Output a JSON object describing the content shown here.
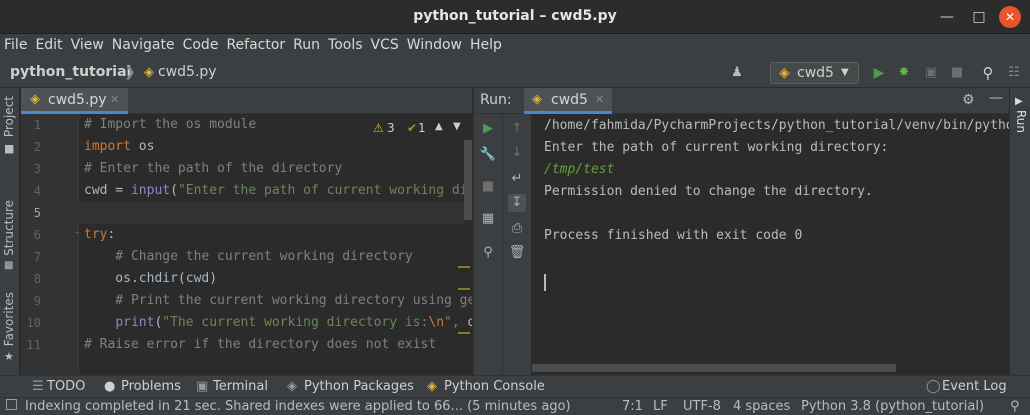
{
  "window": {
    "title": "python_tutorial – cwd5.py"
  },
  "menu": [
    "File",
    "Edit",
    "View",
    "Navigate",
    "Code",
    "Refactor",
    "Run",
    "Tools",
    "VCS",
    "Window",
    "Help"
  ],
  "breadcrumb": {
    "project": "python_tutorial",
    "file": "cwd5.py"
  },
  "run_config": {
    "name": "cwd5"
  },
  "side_tools": {
    "project": "Project",
    "structure": "Structure",
    "favorites": "Favorites",
    "run": "Run"
  },
  "editor": {
    "tab": "cwd5.py",
    "warnings": "3",
    "weak_warnings": "1",
    "current_line": 5,
    "lines": [
      {
        "num": "1",
        "tokens": [
          {
            "t": "# Import the os module",
            "c": "com"
          }
        ]
      },
      {
        "num": "2",
        "tokens": [
          {
            "t": "import",
            "c": "kw"
          },
          {
            "t": " os",
            "c": "def"
          }
        ]
      },
      {
        "num": "3",
        "tokens": [
          {
            "t": "# Enter the path of the directory",
            "c": "com"
          }
        ]
      },
      {
        "num": "4",
        "tokens": [
          {
            "t": "cwd = ",
            "c": "def"
          },
          {
            "t": "input",
            "c": "fn"
          },
          {
            "t": "(",
            "c": "def"
          },
          {
            "t": "\"Enter the path of current working directory: \"",
            "c": "str"
          }
        ]
      },
      {
        "num": "5",
        "tokens": []
      },
      {
        "num": "6",
        "tokens": [
          {
            "t": "try",
            "c": "kw"
          },
          {
            "t": ":",
            "c": "def"
          }
        ]
      },
      {
        "num": "7",
        "tokens": [
          {
            "t": "    # Change the current working directory",
            "c": "com"
          }
        ]
      },
      {
        "num": "8",
        "tokens": [
          {
            "t": "    os.chdir(cwd)",
            "c": "def"
          }
        ]
      },
      {
        "num": "9",
        "tokens": [
          {
            "t": "    # Print the current working directory using getcwd()",
            "c": "com"
          }
        ]
      },
      {
        "num": "10",
        "tokens": [
          {
            "t": "    ",
            "c": "def"
          },
          {
            "t": "print",
            "c": "fn"
          },
          {
            "t": "(",
            "c": "def"
          },
          {
            "t": "\"The current working directory is:",
            "c": "str"
          },
          {
            "t": "\\n",
            "c": "esc"
          },
          {
            "t": "\", ",
            "c": "str"
          },
          {
            "t": "os.getcwd())",
            "c": "def"
          }
        ]
      },
      {
        "num": "11",
        "tokens": [
          {
            "t": "# Raise error if the directory does not exist",
            "c": "com"
          }
        ]
      }
    ]
  },
  "run": {
    "label": "Run:",
    "tab": "cwd5",
    "output": [
      {
        "text": "/home/fahmida/PycharmProjects/python_tutorial/venv/bin/python",
        "kind": "out"
      },
      {
        "text": "Enter the path of current working directory:",
        "kind": "out"
      },
      {
        "text": "/tmp/test",
        "kind": "in"
      },
      {
        "text": "Permission denied to change the directory.",
        "kind": "out"
      },
      {
        "text": "",
        "kind": "out"
      },
      {
        "text": "Process finished with exit code 0",
        "kind": "out"
      }
    ]
  },
  "bottom_tools": [
    "TODO",
    "Problems",
    "Terminal",
    "Python Packages",
    "Python Console",
    "Event Log"
  ],
  "status": {
    "message": "Indexing completed in 21 sec. Shared indexes were applied to 66... (5 minutes ago)",
    "position": "7:1",
    "line_sep": "LF",
    "encoding": "UTF-8",
    "indent": "4 spaces",
    "interpreter": "Python 3.8 (python_tutorial)"
  },
  "colors": {
    "accent": "#4a88c7",
    "run_green": "#499c54",
    "close_button": "#e9542d"
  }
}
